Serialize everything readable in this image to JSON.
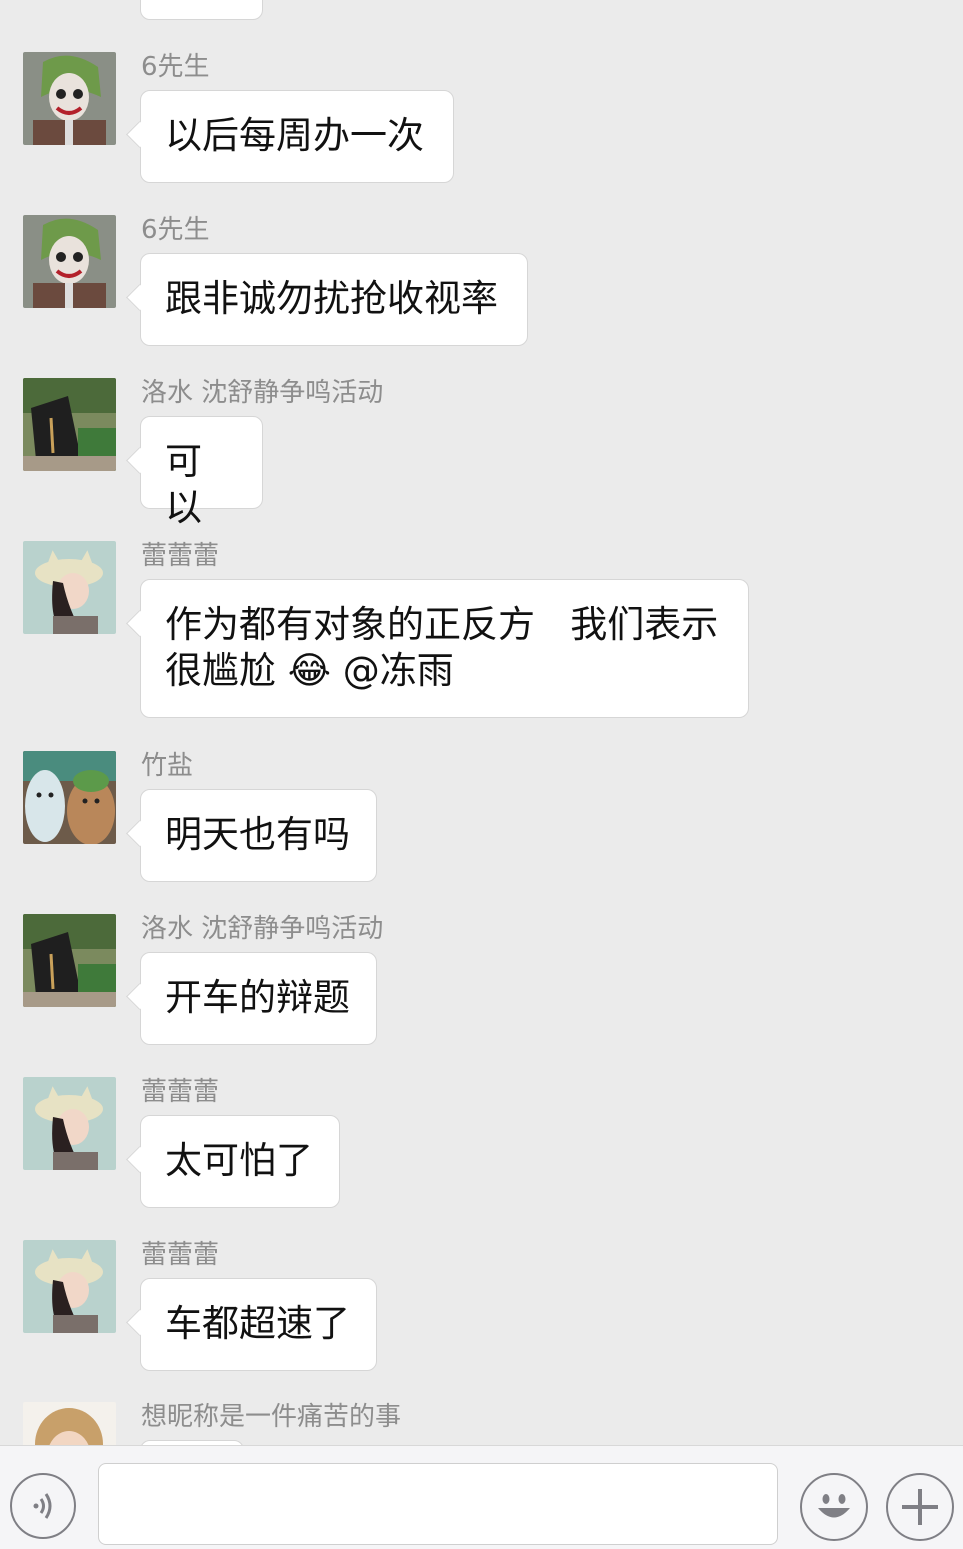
{
  "messages": [
    {
      "sender": "6先生",
      "text": "以后每周办一次",
      "avatar": "joker-avatar"
    },
    {
      "sender": "6先生",
      "text": "跟非诚勿扰抢收视率",
      "avatar": "joker-avatar"
    },
    {
      "sender": "洛水 沈舒静争鸣活动",
      "text": "可以",
      "avatar": "stone-avatar"
    },
    {
      "sender": "蕾蕾蕾",
      "text": "作为都有对象的正反方   我们表示\n很尴尬 😂 @冻雨",
      "avatar": "girl-hat-avatar"
    },
    {
      "sender": "竹盐",
      "text": "明天也有吗",
      "avatar": "bears-avatar"
    },
    {
      "sender": "洛水 沈舒静争鸣活动",
      "text": "开车的辩题",
      "avatar": "stone-avatar"
    },
    {
      "sender": "蕾蕾蕾",
      "text": "太可怕了",
      "avatar": "girl-hat-avatar"
    },
    {
      "sender": "蕾蕾蕾",
      "text": "车都超速了",
      "avatar": "girl-hat-avatar"
    },
    {
      "sender": "想昵称是一件痛苦的事",
      "text": "",
      "avatar": "blonde-avatar"
    }
  ],
  "input_bar": {
    "voice_icon": "voice-icon",
    "emoji_icon": "emoji-icon",
    "plus_icon": "plus-icon",
    "input_value": ""
  }
}
